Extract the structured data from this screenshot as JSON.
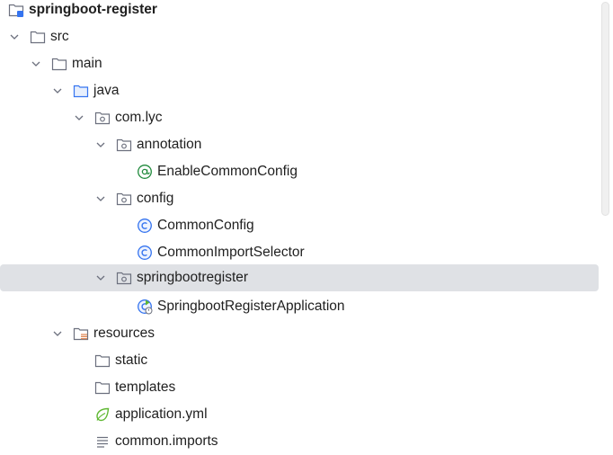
{
  "tree": {
    "project": {
      "label": "springboot-register",
      "icon": "module-folder-icon"
    },
    "src": {
      "label": "src",
      "icon": "folder-icon"
    },
    "main": {
      "label": "main",
      "icon": "folder-icon"
    },
    "java": {
      "label": "java",
      "icon": "source-root-folder-icon"
    },
    "pkg_root": {
      "label": "com.lyc",
      "icon": "package-icon"
    },
    "pkg_annotation": {
      "label": "annotation",
      "icon": "package-icon"
    },
    "file_enable": {
      "label": "EnableCommonConfig",
      "icon": "annotation-icon"
    },
    "pkg_config": {
      "label": "config",
      "icon": "package-icon"
    },
    "file_common_config": {
      "label": "CommonConfig",
      "icon": "class-icon"
    },
    "file_import_selector": {
      "label": "CommonImportSelector",
      "icon": "class-icon"
    },
    "pkg_springbootregister": {
      "label": "springbootregister",
      "icon": "package-icon"
    },
    "file_app": {
      "label": "SpringbootRegisterApplication",
      "icon": "spring-boot-class-icon"
    },
    "resources": {
      "label": "resources",
      "icon": "resources-root-folder-icon"
    },
    "static": {
      "label": "static",
      "icon": "folder-icon"
    },
    "templates": {
      "label": "templates",
      "icon": "folder-icon"
    },
    "application_yml": {
      "label": "application.yml",
      "icon": "spring-config-icon"
    },
    "common_imports": {
      "label": "common.imports",
      "icon": "text-file-icon"
    }
  },
  "colors": {
    "selection": "#dfe1e5",
    "class_blue": "#3574f0",
    "annotation_green": "#208a3c",
    "spring_green": "#5fb832",
    "resources_orange": "#e08855"
  }
}
